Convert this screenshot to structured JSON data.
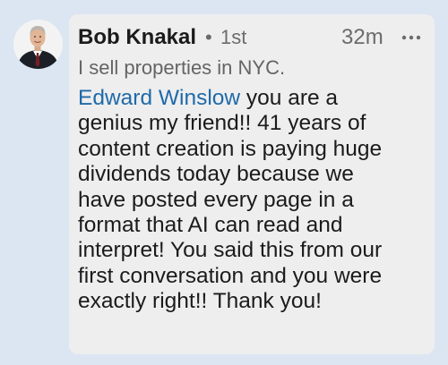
{
  "comment": {
    "author_name": "Bob Knakal",
    "separator": "•",
    "connection_degree": "1st",
    "timestamp": "32m",
    "headline": "I sell properties in NYC.",
    "mention": "Edward Winslow",
    "body_lines": [
      " you are a",
      "genius my friend!! 41 years of",
      "content creation is paying huge",
      "dividends today because we",
      "have posted every page in a",
      "format that AI can read and",
      "interpret! You said this from our",
      "first conversation and you were",
      "exactly right!! Thank you!"
    ]
  },
  "colors": {
    "background": "#dce6f2",
    "card": "#eeeeef",
    "mention": "#1f6aa8",
    "text": "#1b1b1b",
    "muted": "#646464"
  },
  "icons": {
    "avatar": "profile-photo",
    "menu": "more-horizontal-icon"
  }
}
